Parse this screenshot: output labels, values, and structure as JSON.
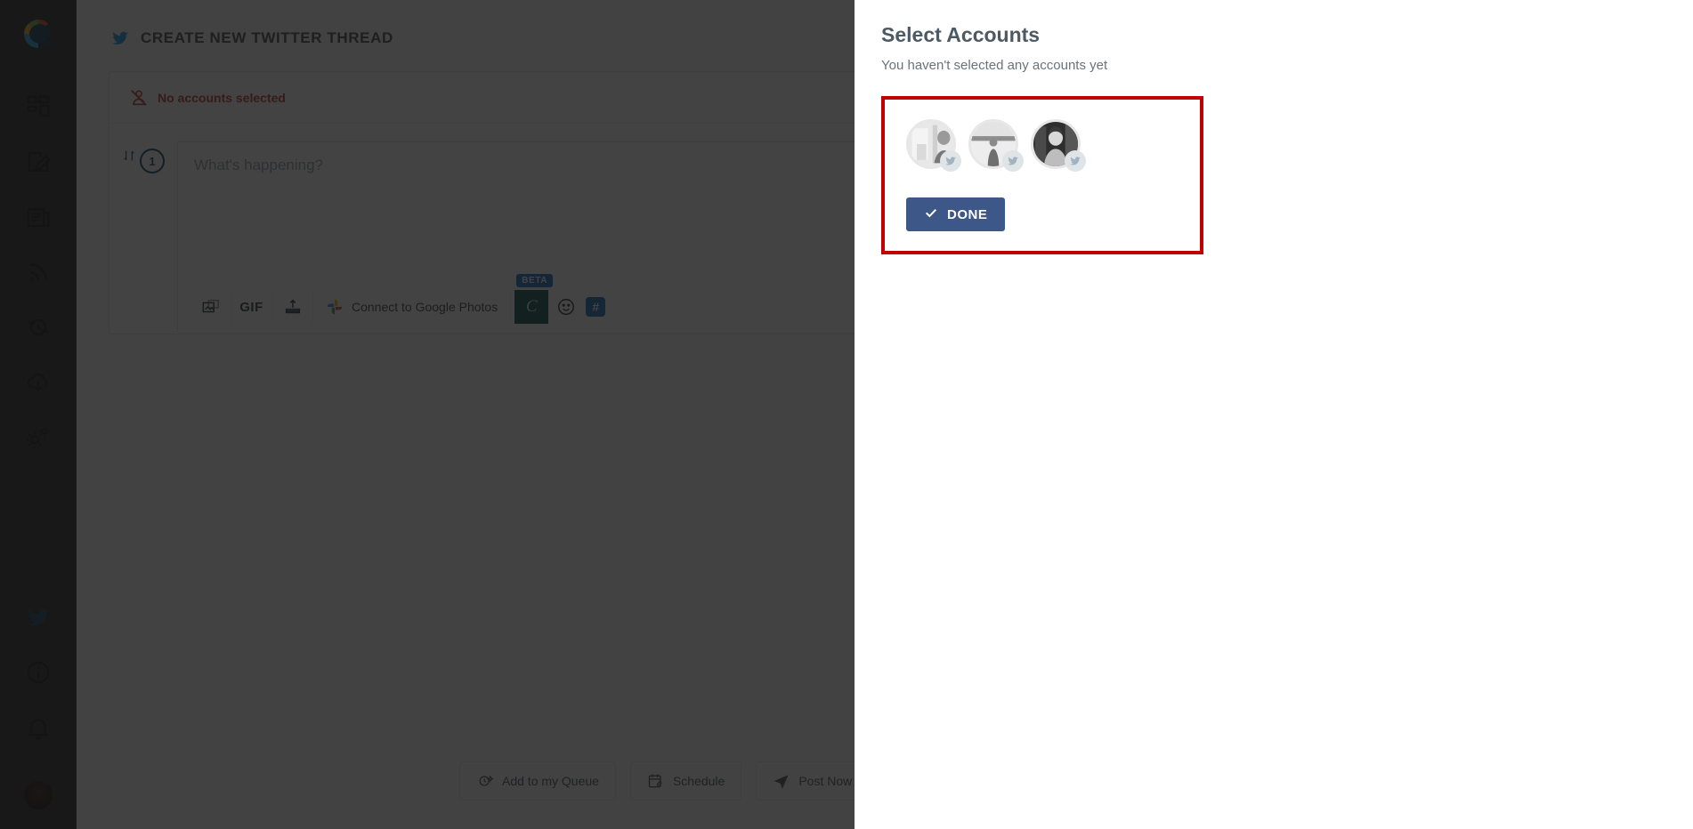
{
  "sidebar": {
    "logo_name": "app-logo",
    "items": [
      {
        "icon": "dashboard-grid-icon",
        "name": "sidebar-item-dashboard"
      },
      {
        "icon": "compose-edit-icon",
        "name": "sidebar-item-compose"
      },
      {
        "icon": "newspaper-icon",
        "name": "sidebar-item-content"
      },
      {
        "icon": "rss-feed-icon",
        "name": "sidebar-item-feeds"
      },
      {
        "icon": "history-clock-icon",
        "name": "sidebar-item-history"
      },
      {
        "icon": "cloud-download-icon",
        "name": "sidebar-item-import"
      },
      {
        "icon": "settings-gears-icon",
        "name": "sidebar-item-settings"
      }
    ],
    "bottom_items": [
      {
        "icon": "twitter-bird-icon",
        "name": "sidebar-item-twitter"
      },
      {
        "icon": "info-circle-icon",
        "name": "sidebar-item-info"
      },
      {
        "icon": "bell-icon",
        "name": "sidebar-item-notifications"
      }
    ],
    "avatar_name": "user-avatar"
  },
  "header": {
    "title": "CREATE NEW TWITTER THREAD",
    "icon": "twitter-bird-icon"
  },
  "accounts_bar": {
    "label": "No accounts selected",
    "icon": "user-slash-icon",
    "chevron": "chevron-right-icon",
    "color": "#c0392b"
  },
  "composer": {
    "thread_number": "1",
    "reorder_icon": "reorder-arrows-icon",
    "placeholder": "What's happening?",
    "toolbar": {
      "image_icon": "image-icon",
      "gif_label": "GIF",
      "upload_icon": "upload-icon",
      "google_photos_label": "Connect to Google Photos",
      "google_photos_icon": "google-photos-icon",
      "beta_badge": "BETA",
      "canva_label": "C",
      "emoji_icon": "emoji-smiley-icon",
      "hashtag_label": "#",
      "add_icon": "plus-icon"
    }
  },
  "bottom_actions": [
    {
      "label": "Add to my Queue",
      "icon": "queue-clock-icon"
    },
    {
      "label": "Schedule",
      "icon": "calendar-icon"
    },
    {
      "label": "Post Now",
      "icon": "send-icon"
    }
  ],
  "panel": {
    "title": "Select Accounts",
    "subtitle": "You haven't selected any accounts yet",
    "accounts": [
      {
        "name": "account-avatar-1",
        "badge": "twitter-badge-icon"
      },
      {
        "name": "account-avatar-2",
        "badge": "twitter-badge-icon"
      },
      {
        "name": "account-avatar-3",
        "badge": "twitter-badge-icon"
      }
    ],
    "done_label": "DONE",
    "done_icon": "check-icon",
    "done_color": "#3c5788",
    "highlight_color": "#c00000"
  }
}
